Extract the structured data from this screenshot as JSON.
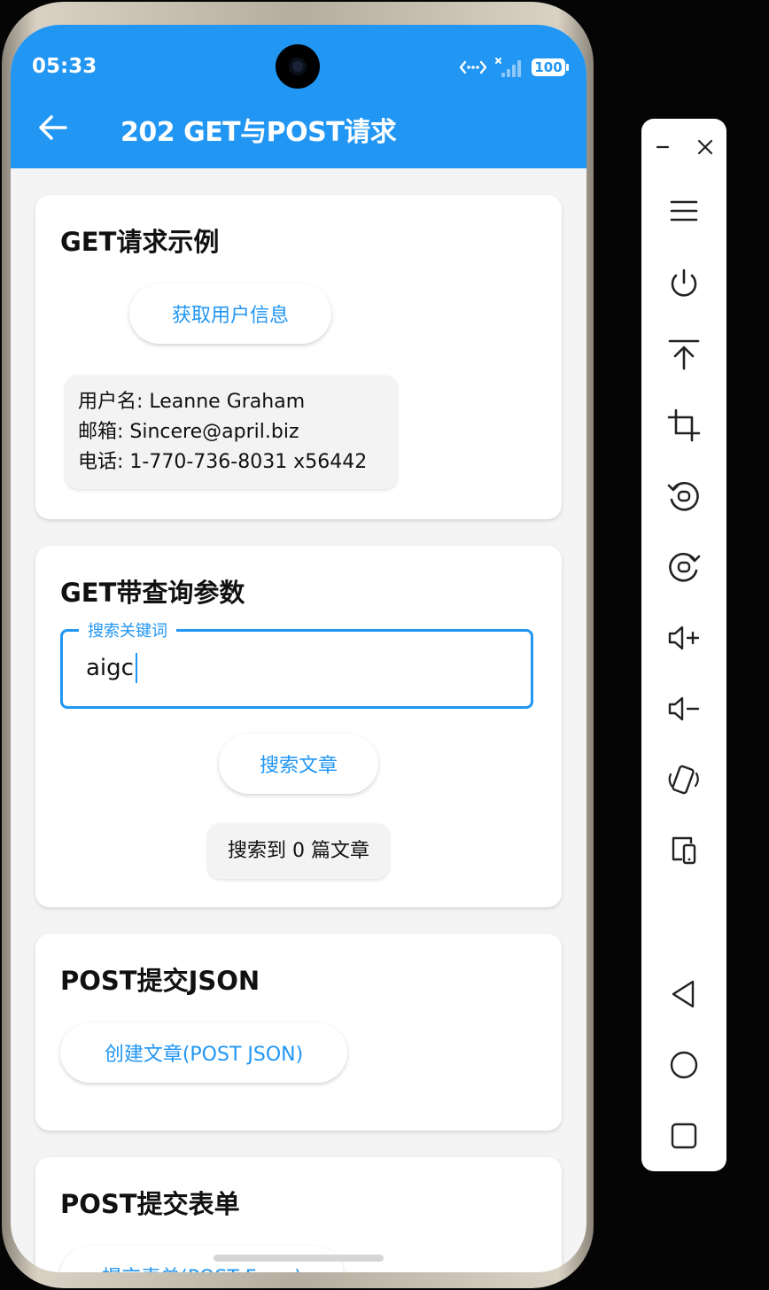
{
  "status_bar": {
    "time": "05:33",
    "battery": "100",
    "icons": [
      "camera-icon",
      "nfc-icon",
      "no-signal-icon",
      "battery-icon"
    ]
  },
  "app_bar": {
    "title": "202 GET与POST请求",
    "back_icon": "arrow-left-icon",
    "color": "#2196F3"
  },
  "get_card": {
    "title": "GET请求示例",
    "button_label": "获取用户信息",
    "user_info": {
      "name_line": "用户名: Leanne Graham",
      "email_line": "邮箱: Sincere@april.biz",
      "phone_line": "电话: 1-770-736-8031 x56442"
    }
  },
  "query_card": {
    "title": "GET带查询参数",
    "search_field": {
      "label": "搜索关键词",
      "value": "aigc"
    },
    "button_label": "搜索文章",
    "result_text": "搜索到 0 篇文章"
  },
  "post_json_card": {
    "title": "POST提交JSON",
    "button_label": "创建文章(POST JSON)"
  },
  "post_form_card": {
    "title": "POST提交表单",
    "button_label": "提交表单(POST Form)"
  },
  "emulator_toolbar": {
    "icons": [
      "minimize-icon",
      "close-icon",
      "menu-icon",
      "power-icon",
      "upload-icon",
      "crop-icon",
      "rotate-left-icon",
      "rotate-right-icon",
      "volume-up-icon",
      "volume-down-icon",
      "shake-icon",
      "device-icon",
      "back-triangle-icon",
      "home-circle-icon",
      "recent-square-icon"
    ]
  }
}
